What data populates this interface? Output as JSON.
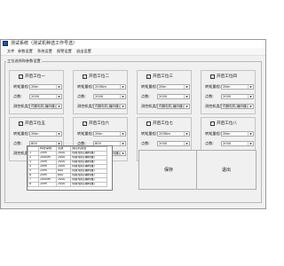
{
  "window": {
    "title": "测试系统（测试机种选工作号选）",
    "icon": "app-icon"
  },
  "menu": [
    {
      "label": "文件"
    },
    {
      "label": "参数设置"
    },
    {
      "label": "系统设置"
    },
    {
      "label": "报警设置"
    },
    {
      "label": "退出设置"
    }
  ],
  "group_title": "工位选择和参数设置",
  "field_labels": {
    "range": "转矩量程:",
    "points": "点数:",
    "motor": "测控机类型:"
  },
  "stations": [
    {
      "checked": true,
      "check_mark": "✓",
      "label": "开启工位一",
      "range": "2Nm",
      "points": "2000",
      "motor": "伺服电机(编码器)"
    },
    {
      "checked": true,
      "check_mark": "✓",
      "label": "开启工位二",
      "range": "200Nm",
      "points": "2000",
      "motor": "伺服电机(编码器)"
    },
    {
      "checked": true,
      "check_mark": "✓",
      "label": "开启工位三",
      "range": "2Nm",
      "points": "2000",
      "motor": "伺服电机(编码器)"
    },
    {
      "checked": true,
      "check_mark": "✓",
      "label": "开启工位四",
      "range": "2Nm",
      "points": "2000",
      "motor": "伺服电机(编码器)"
    },
    {
      "checked": true,
      "check_mark": "✓",
      "label": "开启工位五",
      "range": "2Nm",
      "points": "800",
      "motor": "伺服电机(编码器)"
    },
    {
      "checked": true,
      "check_mark": "✓",
      "label": "开启工位六",
      "range": "2Nm",
      "points": "800",
      "motor": "伺服电机(编码器)"
    },
    {
      "checked": false,
      "check_mark": "",
      "label": "开启工位七",
      "range": "200Nm",
      "points": "2000",
      "motor": "伺服电机(编码器)"
    },
    {
      "checked": false,
      "check_mark": "",
      "label": "开启工位八",
      "range": "2Nm",
      "points": "2000",
      "motor": "伺服电机(编码器)"
    }
  ],
  "table": {
    "headers": [
      "",
      "转矩量程",
      "点数",
      "测控机类型"
    ],
    "rows": [
      [
        "1",
        "2Nm",
        "2000",
        "伺服电机(编码器)"
      ],
      [
        "2",
        "200Nm",
        "2000",
        "伺服电机(编码器)"
      ],
      [
        "3",
        "2Nm",
        "2000",
        "伺服电机(编码器)"
      ],
      [
        "4",
        "2Nm",
        "2000",
        "伺服电机(编码器)"
      ],
      [
        "5",
        "2Nm",
        "800",
        "伺服电机(编码器)"
      ],
      [
        "6",
        "2Nm",
        "800",
        "伺服电机(编码器)"
      ],
      [
        "7",
        "200Nm",
        "2000",
        "伺服电机(编码器)"
      ],
      [
        "8",
        "2Nm",
        "2000",
        "伺服电机(编码器)"
      ]
    ]
  },
  "buttons": {
    "save": "保存",
    "exit": "退出"
  }
}
